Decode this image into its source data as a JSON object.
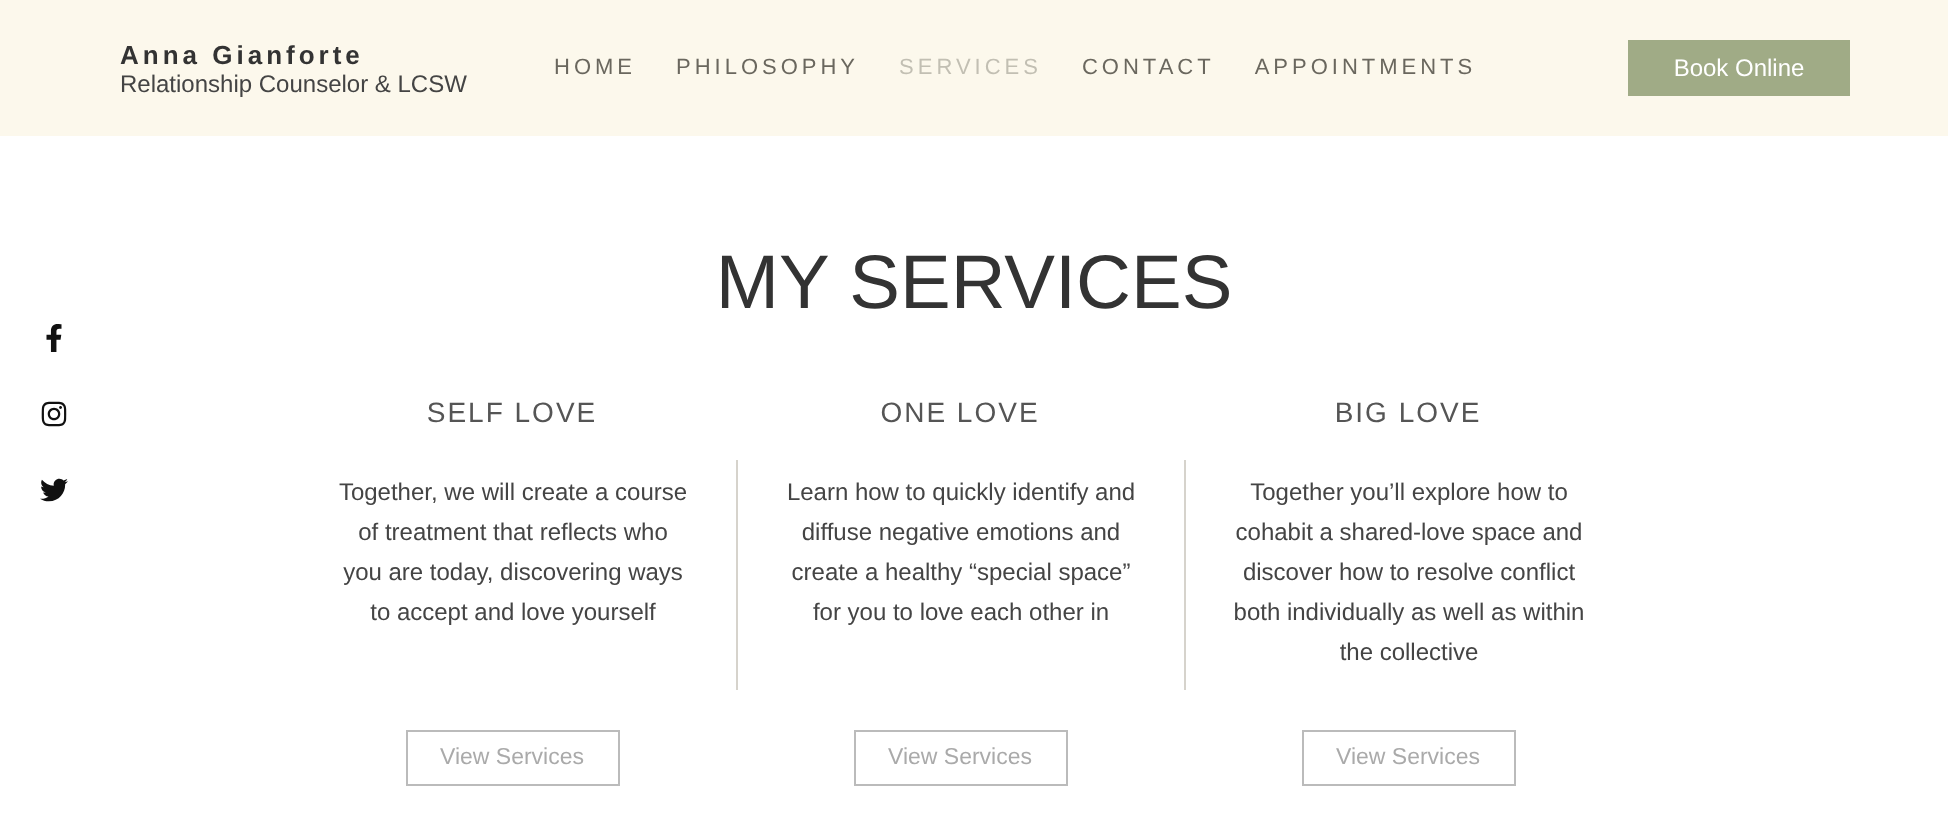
{
  "brand": {
    "name": "Anna Gianforte",
    "subtitle": "Relationship Counselor & LCSW"
  },
  "nav": [
    {
      "label": "HOME",
      "selected": false
    },
    {
      "label": "PHILOSOPHY",
      "selected": false
    },
    {
      "label": "SERVICES",
      "selected": true
    },
    {
      "label": "CONTACT",
      "selected": false
    },
    {
      "label": "APPOINTMENTS",
      "selected": false
    }
  ],
  "book_button": "Book Online",
  "social": [
    {
      "kind": "facebook"
    },
    {
      "kind": "instagram"
    },
    {
      "kind": "twitter"
    }
  ],
  "title": "MY SERVICES",
  "services": [
    {
      "name": "SELF LOVE",
      "description": "Together, we will create a course of treatment that reflects who you are today, discovering ways to accept and love yourself",
      "button": "View Services"
    },
    {
      "name": "ONE LOVE",
      "description": "Learn how to quickly identify and diffuse negative emotions and create a healthy “special space” for you to love each other in",
      "button": "View Services"
    },
    {
      "name": "BIG LOVE",
      "description": "Together you’ll explore how to cohabit a shared-love space and discover how to resolve conflict both individually as well as within the collective",
      "button": "View Services"
    }
  ]
}
